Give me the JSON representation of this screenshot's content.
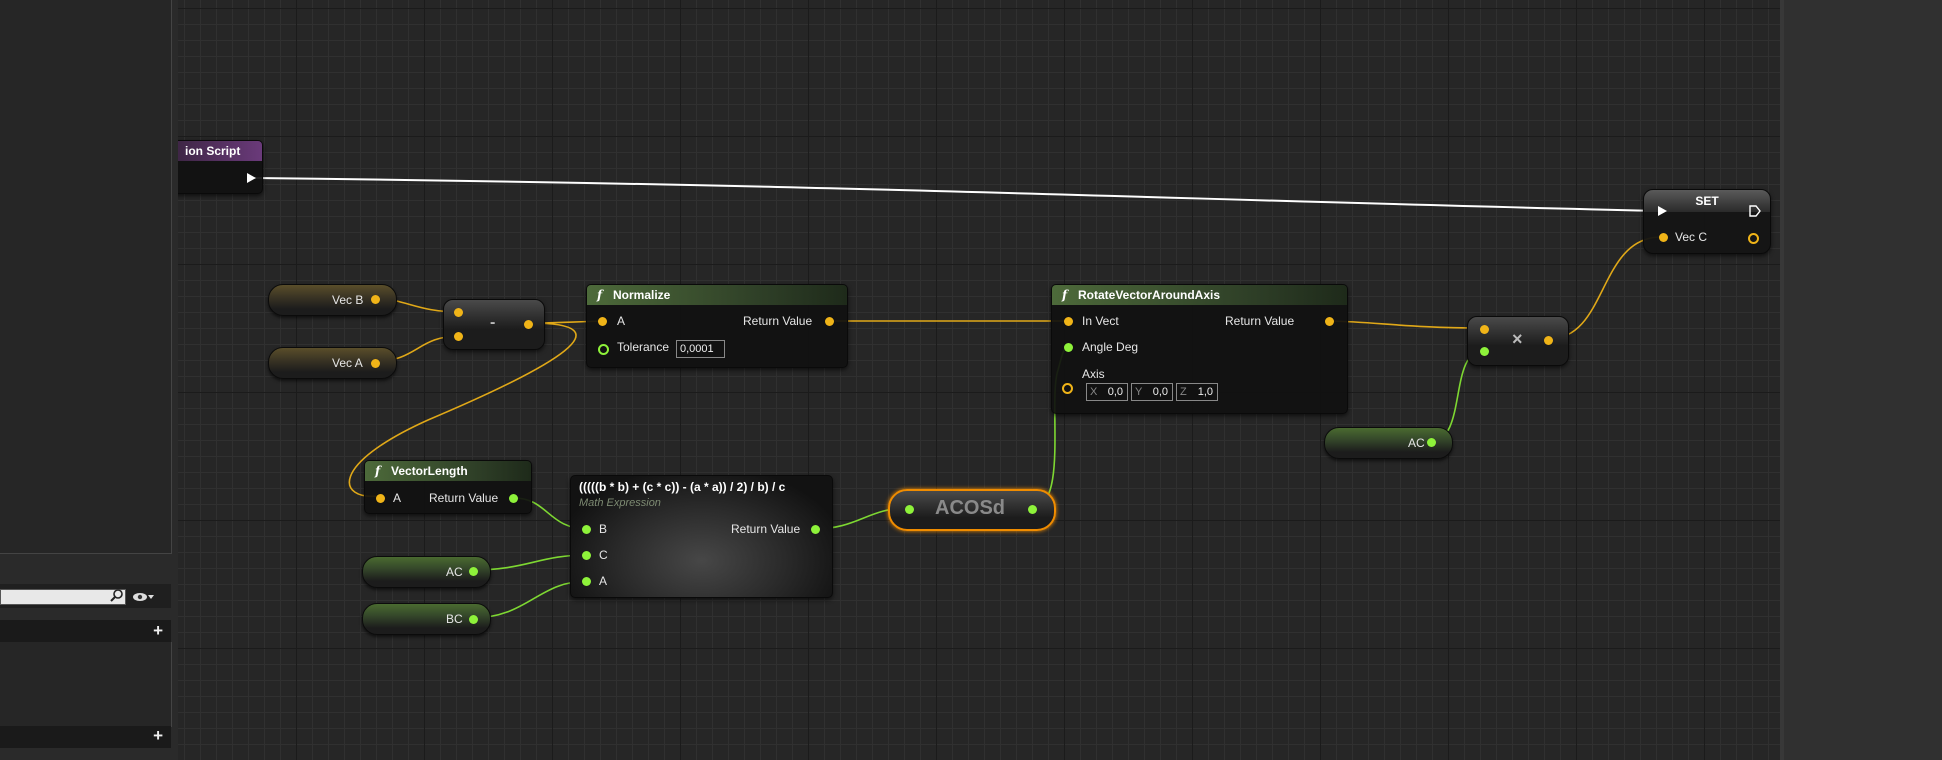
{
  "panels": {
    "search_placeholder": ""
  },
  "nodes": {
    "construction_script": {
      "title": "ion Script"
    },
    "set": {
      "title": "SET",
      "pin_vec_c": "Vec C"
    },
    "vec_b": {
      "label": "Vec B"
    },
    "vec_a": {
      "label": "Vec A"
    },
    "subtract": {
      "symbol": "-"
    },
    "normalize": {
      "title": "Normalize",
      "pin_a": "A",
      "pin_tolerance": "Tolerance",
      "tolerance_value": "0,0001",
      "pin_return": "Return Value"
    },
    "rotate": {
      "title": "RotateVectorAroundAxis",
      "pin_invect": "In Vect",
      "pin_angle": "Angle Deg",
      "pin_axis": "Axis",
      "pin_return": "Return Value",
      "axis_x_label": "X",
      "axis_x": "0,0",
      "axis_y_label": "Y",
      "axis_y": "0,0",
      "axis_z_label": "Z",
      "axis_z": "1,0"
    },
    "multiply": {
      "symbol": "×"
    },
    "ac_right": {
      "label": "AC"
    },
    "vector_length": {
      "title": "VectorLength",
      "pin_a": "A",
      "pin_return": "Return Value"
    },
    "math_expr": {
      "title": "(((((b * b) + (c * c)) - (a * a)) / 2) / b) / c",
      "subtitle": "Math Expression",
      "pin_b": "B",
      "pin_c": "C",
      "pin_a": "A",
      "pin_return": "Return Value"
    },
    "acosd": {
      "label": "ACOSd"
    },
    "ac_left": {
      "label": "AC"
    },
    "bc": {
      "label": "BC"
    }
  },
  "colors": {
    "vector_pin": "#f0b418",
    "float_pin": "#8ef23a",
    "exec_wire": "#ffffff",
    "function_header": "#4d6a3a",
    "event_header": "#6a3a7a",
    "selection": "#f08c00"
  }
}
